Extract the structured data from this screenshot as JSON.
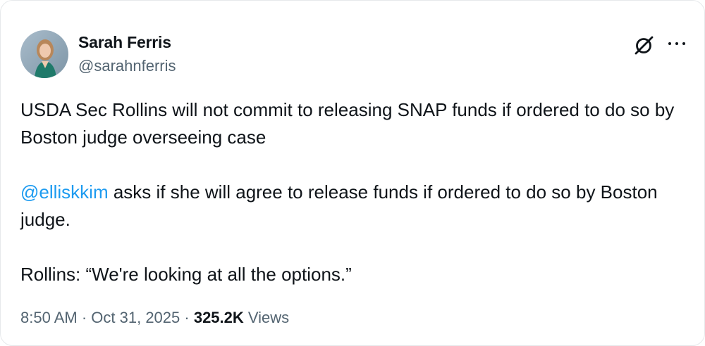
{
  "author": {
    "name": "Sarah Ferris",
    "handle": "@sarahnferris",
    "avatar_icon": "profile-photo"
  },
  "icons": {
    "grok": "grok-icon",
    "more": "more-options-icon"
  },
  "tweet": {
    "paragraph1": "USDA Sec Rollins will not commit to releasing SNAP funds if ordered to do so by Boston judge overseeing case",
    "mention": "@elliskkim",
    "paragraph2_rest": " asks if she will agree to release funds if ordered to do so by Boston judge.",
    "paragraph3": "Rollins: “We're looking at all the options.”"
  },
  "meta": {
    "time": "8:50 AM",
    "separator1": " · ",
    "date": "Oct 31, 2025",
    "separator2": " · ",
    "views_count": "325.2K",
    "views_label": " Views"
  },
  "colors": {
    "text": "#0f1419",
    "secondary": "#536471",
    "link": "#1d9bf0",
    "avatar_bg": "#8aa2b3",
    "avatar_clothing": "#1f7a6a"
  }
}
